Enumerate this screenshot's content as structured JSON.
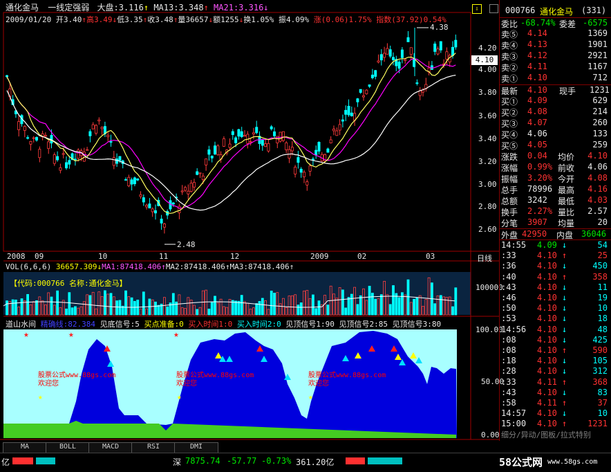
{
  "header": {
    "name": "通化金马",
    "indicator": "一线定强弱",
    "dapan_label": "大盘:3.116",
    "ma13_label": "MA13:3.348",
    "ma21_label": "MA21:3.316",
    "date": "2009/01/20",
    "open": "开3.40",
    "high": "高3.49",
    "low": "低3.35",
    "close": "收3.48",
    "volume": "量36657",
    "amount": "额1255",
    "turnover": "换1.05%",
    "amplitude": "振4.09%",
    "change": "涨(0.06)1.75%",
    "index": "指数(37.92)0.54%"
  },
  "price_axis": [
    "4.20",
    "4.00",
    "3.80",
    "3.60",
    "3.40",
    "3.20",
    "3.00",
    "2.80",
    "2.60"
  ],
  "current_price_tag": "4.10",
  "price_marks": {
    "high": "4.38",
    "low": "2.48"
  },
  "date_axis": [
    "2008",
    "09",
    "10",
    "11",
    "12",
    "2009",
    "02",
    "03"
  ],
  "period_label": "日线",
  "volume_header": {
    "vol": "VOL(6,6,6)",
    "vol_value": "36657.309",
    "ma1": "MA1:87418.406",
    "ma2": "MA2:87418.406",
    "ma3": "MA3:87418.406"
  },
  "volume_axis": "100000",
  "volume_info": "【代码:000766 名称:通化金马】",
  "indicator_header": {
    "name": "道山水间",
    "r1": "精确线:82.384",
    "r2": "见底信号:5",
    "r3": "买点准备:0",
    "r4": "买入时间1:0",
    "r5": "买入时间2:0",
    "r6": "见顶信号1:90",
    "r7": "见顶信号2:85",
    "r8": "见顶信号3:80"
  },
  "indicator_axis": [
    "100.00",
    "50.00",
    "0.00"
  ],
  "watermarks": [
    {
      "line1": "股票公式www.88gs.com",
      "line2": "欢迎您"
    },
    {
      "line1": "股票公式www.88gs.com",
      "line2": "欢迎您"
    },
    {
      "line1": "股票公式www.88gs.com",
      "line2": "欢迎您"
    }
  ],
  "tabs": [
    "MA",
    "BOLL",
    "MACD",
    "RSI",
    "DMI"
  ],
  "quote": {
    "code": "000766",
    "name": "通化金马",
    "count": "(331)",
    "wei_bi_label": "委比",
    "wei_bi": "-68.74%",
    "wei_cha_label": "委差",
    "wei_cha": "-6575",
    "asks": [
      {
        "label": "卖⑤",
        "price": "4.14",
        "vol": "1369"
      },
      {
        "label": "卖④",
        "price": "4.13",
        "vol": "1901"
      },
      {
        "label": "卖③",
        "price": "4.12",
        "vol": "2921"
      },
      {
        "label": "卖②",
        "price": "4.11",
        "vol": "1167"
      },
      {
        "label": "卖①",
        "price": "4.10",
        "vol": "712"
      }
    ],
    "latest_label": "最新",
    "latest": "4.10",
    "cur_vol_label": "现手",
    "cur_vol": "1231",
    "bids": [
      {
        "label": "买①",
        "price": "4.09",
        "vol": "629"
      },
      {
        "label": "买②",
        "price": "4.08",
        "vol": "214"
      },
      {
        "label": "买③",
        "price": "4.07",
        "vol": "260"
      },
      {
        "label": "买④",
        "price": "4.06",
        "vol": "133"
      },
      {
        "label": "买⑤",
        "price": "4.05",
        "vol": "259"
      }
    ],
    "stats": [
      {
        "l1": "涨跌",
        "v1": "0.04",
        "l2": "均价",
        "v2": "4.10"
      },
      {
        "l1": "涨幅",
        "v1": "0.99%",
        "l2": "前收",
        "v2": "4.06"
      },
      {
        "l1": "振幅",
        "v1": "3.20%",
        "l2": "今开",
        "v2": "4.08"
      },
      {
        "l1": "总手",
        "v1": "78996",
        "l2": "最高",
        "v2": "4.16"
      },
      {
        "l1": "总额",
        "v1": "3242",
        "l2": "最低",
        "v2": "4.03"
      },
      {
        "l1": "换手",
        "v1": "2.27%",
        "l2": "量比",
        "v2": "2.57"
      },
      {
        "l1": "分笔",
        "v1": "3907",
        "l2": "均量",
        "v2": "20"
      }
    ],
    "outer_label": "外盘",
    "outer": "42950",
    "inner_label": "内盘",
    "inner": "36046"
  },
  "ticks": [
    {
      "t": "14:55",
      "p": "4.09",
      "d": "↓",
      "v": "54"
    },
    {
      "t": ":33",
      "p": "4.10",
      "d": "↑",
      "v": "25"
    },
    {
      "t": ":36",
      "p": "4.10",
      "d": "↓",
      "v": "450"
    },
    {
      "t": ":40",
      "p": "4.10",
      "d": "↑",
      "v": "358"
    },
    {
      "t": ":43",
      "p": "4.10",
      "d": "↓",
      "v": "11"
    },
    {
      "t": ":46",
      "p": "4.10",
      "d": "↓",
      "v": "19"
    },
    {
      "t": ":50",
      "p": "4.10",
      "d": "↓",
      "v": "10"
    },
    {
      "t": ":53",
      "p": "4.10",
      "d": "↓",
      "v": "18"
    },
    {
      "t": "14:56",
      "p": "4.10",
      "d": "↓",
      "v": "48"
    },
    {
      "t": ":08",
      "p": "4.10",
      "d": "↓",
      "v": "425"
    },
    {
      "t": ":08",
      "p": "4.10",
      "d": "↑",
      "v": "590"
    },
    {
      "t": ":18",
      "p": "4.10",
      "d": "↓",
      "v": "105"
    },
    {
      "t": ":28",
      "p": "4.10",
      "d": "↓",
      "v": "312"
    },
    {
      "t": ":33",
      "p": "4.11",
      "d": "↑",
      "v": "368"
    },
    {
      "t": ":43",
      "p": "4.10",
      "d": "↓",
      "v": "83"
    },
    {
      "t": ":58",
      "p": "4.11",
      "d": "↑",
      "v": "37"
    },
    {
      "t": "14:57",
      "p": "4.10",
      "d": "↓",
      "v": "10"
    },
    {
      "t": "15:00",
      "p": "4.10",
      "d": "↑",
      "v": "1231"
    }
  ],
  "right_footer": "细分/异动/图板/拉式特别",
  "status_bar": {
    "left": "亿",
    "shen_label": "深",
    "shen_index": "7875.74",
    "shen_change": "-57.77",
    "shen_pct": "-0.73%",
    "shen_amount": "361.20亿",
    "logo": "58公式网",
    "logo_url": "www.58gs.com"
  }
}
